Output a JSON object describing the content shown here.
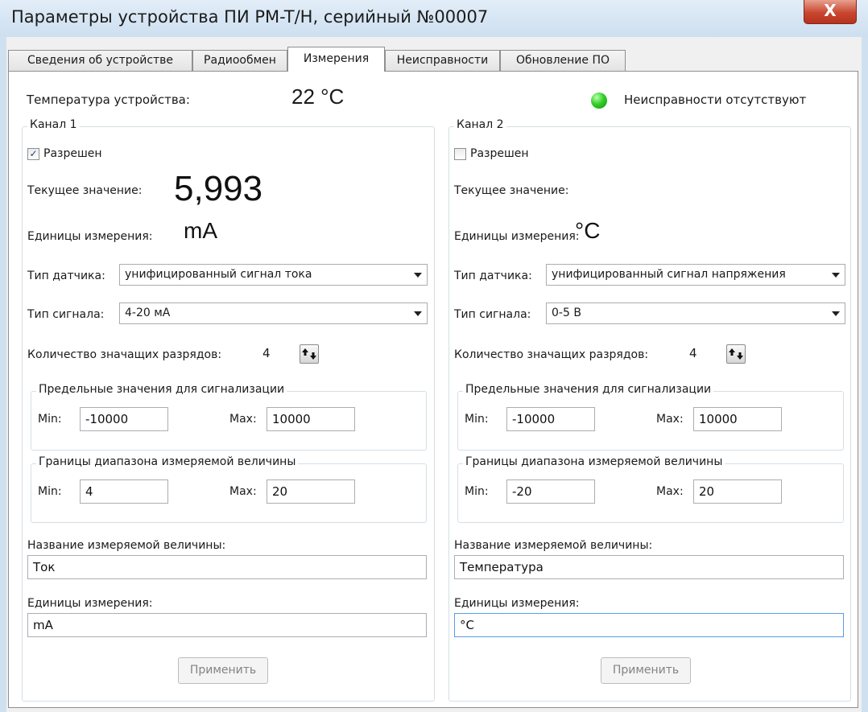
{
  "window": {
    "title": "Параметры устройства ПИ PM-T/H, серийный №00007",
    "close_label": "X"
  },
  "tabs": [
    {
      "label": "Сведения об устройстве",
      "active": false
    },
    {
      "label": "Радиообмен",
      "active": false
    },
    {
      "label": "Измерения",
      "active": true
    },
    {
      "label": "Неисправности",
      "active": false
    },
    {
      "label": "Обновление ПО",
      "active": false
    }
  ],
  "header": {
    "temperature_label": "Температура устройства:",
    "temperature_value": "22 °C",
    "status_text": "Неисправности отсутствуют",
    "status_color": "#34d027"
  },
  "channels": [
    {
      "title": "Канал 1",
      "enabled_label": "Разрешен",
      "enabled": true,
      "check_mark": "✓",
      "current_label": "Текущее значение:",
      "current_value": "5,993",
      "units_label": "Единицы измерения:",
      "units_value": "mA",
      "sensor_type_label": "Тип датчика:",
      "sensor_type_value": "унифицированный сигнал тока",
      "signal_type_label": "Тип сигнала:",
      "signal_type_value": "4-20 мА",
      "digits_label": "Количество значащих разрядов:",
      "digits_value": "4",
      "alarm_group_title": "Предельные значения для сигнализации",
      "alarm_min_label": "Min:",
      "alarm_min_value": "-10000",
      "alarm_max_label": "Max:",
      "alarm_max_value": "10000",
      "range_group_title": "Границы диапазона измеряемой величины",
      "range_min_label": "Min:",
      "range_min_value": "4",
      "range_max_label": "Max:",
      "range_max_value": "20",
      "name_label": "Название измеряемой величины:",
      "name_value": "Ток",
      "units_field_label": "Единицы измерения:",
      "units_field_value": "mA",
      "apply_label": "Применить"
    },
    {
      "title": "Канал 2",
      "enabled_label": "Разрешен",
      "enabled": false,
      "check_mark": "",
      "current_label": "Текущее значение:",
      "current_value": "",
      "units_label": "Единицы измерения:",
      "units_value": "°C",
      "sensor_type_label": "Тип датчика:",
      "sensor_type_value": "унифицированный сигнал напряжения",
      "signal_type_label": "Тип сигнала:",
      "signal_type_value": "0-5 В",
      "digits_label": "Количество значащих разрядов:",
      "digits_value": "4",
      "alarm_group_title": "Предельные значения для сигнализации",
      "alarm_min_label": "Min:",
      "alarm_min_value": "-10000",
      "alarm_max_label": "Max:",
      "alarm_max_value": "10000",
      "range_group_title": "Границы диапазона измеряемой величины",
      "range_min_label": "Min:",
      "range_min_value": "-20",
      "range_max_label": "Max:",
      "range_max_value": "20",
      "name_label": "Название измеряемой величины:",
      "name_value": "Температура",
      "units_field_label": "Единицы измерения:",
      "units_field_value": "°C",
      "apply_label": "Применить"
    }
  ]
}
